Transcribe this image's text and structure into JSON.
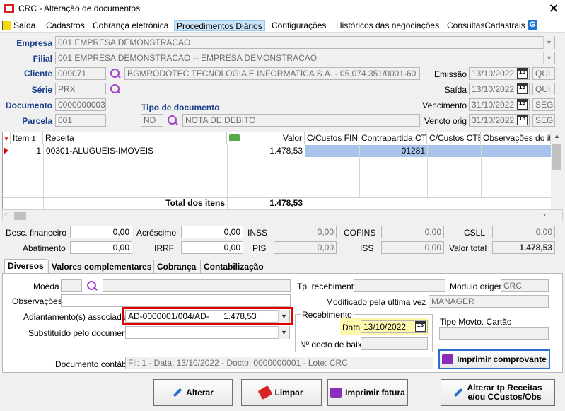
{
  "window": {
    "title": "CRC - Alteração de documentos",
    "close_label": "✕"
  },
  "menu": [
    {
      "label": "Saída"
    },
    {
      "label": "Cadastros"
    },
    {
      "label": "Cobrança eletrônica"
    },
    {
      "label": "Procedimentos Diários"
    },
    {
      "label": "Configurações"
    },
    {
      "label": "Históricos das negociações"
    },
    {
      "label": "ConsultasCadastrais"
    }
  ],
  "menu_g_icon": "G",
  "header": {
    "empresa_label": "Empresa",
    "empresa_value": "001 EMPRESA DEMONSTRACAO",
    "filial_label": "Filial",
    "filial_value": "001 EMPRESA DEMONSTRACAO -- EMPRESA DEMONSTRACAO",
    "cliente_label": "Cliente",
    "cliente_code": "009071",
    "cliente_name": "BGMRODOTEC TECNOLOGIA E INFORMATICA S.A. - 05.074.351/0001-60",
    "serie_label": "Série",
    "serie_value": "PRX",
    "documento_label": "Documento",
    "documento_value": "0000000003",
    "parcela_label": "Parcela",
    "parcela_value": "001",
    "tipo_doc_label": "Tipo de documento",
    "tipo_doc_code": "ND",
    "tipo_doc_name": "NOTA DE DEBITO",
    "emissao_label": "Emissão",
    "emissao_date": "13/10/2022",
    "emissao_day": "QUI",
    "saida_label": "Saída",
    "saida_date": "13/10/2022",
    "saida_day": "QUI",
    "vencimento_label": "Vencimento",
    "vencimento_date": "31/10/2022",
    "vencimento_day": "SEG",
    "vencto_orig_label": "Vencto orig",
    "vencto_orig_date": "31/10/2022",
    "vencto_orig_day": "SEG",
    "cal_glyph": "15"
  },
  "grid": {
    "columns": [
      "Item",
      "Receita",
      "Valor",
      "C/Custos FIN",
      "Contrapartida CTB",
      "C/Custos CTB",
      "Observações do item"
    ],
    "sort_glyph": "1",
    "rows": [
      {
        "item": "1",
        "receita": "00301-ALUGUEIS-IMOVEIS",
        "valor": "1.478,53",
        "ccustos_fin": "",
        "contrapartida": "01281",
        "ccustos_ctb": "",
        "obs": ""
      }
    ],
    "total_label": "Total dos itens",
    "total_value": "1.478,53"
  },
  "totals": {
    "desc_fin_label": "Desc. financeiro",
    "desc_fin": "0,00",
    "acrescimo_label": "Acréscimo",
    "acrescimo": "0,00",
    "inss_label": "INSS",
    "inss": "0,00",
    "cofins_label": "COFINS",
    "cofins": "0,00",
    "csll_label": "CSLL",
    "csll": "0,00",
    "abatimento_label": "Abatimento",
    "abatimento": "0,00",
    "irrf_label": "IRRF",
    "irrf": "0,00",
    "pis_label": "PIS",
    "pis": "0,00",
    "iss_label": "ISS",
    "iss": "0,00",
    "valor_total_label": "Valor total",
    "valor_total": "1.478,53"
  },
  "tabs": [
    {
      "label": "Diversos"
    },
    {
      "label": "Valores complementares"
    },
    {
      "label": "Cobrança"
    },
    {
      "label": "Contabilização"
    }
  ],
  "diversos": {
    "moeda_label": "Moeda",
    "moeda_value": "",
    "observacoes_label": "Observações",
    "observacoes_value": "",
    "adiantamento_label": "Adiantamento(s) associado(s)",
    "adiantamento_doc": "AD-0000001/004/AD-",
    "adiantamento_valor": "1.478,53",
    "substituido_label": "Substituído pelo documento",
    "substituido_value": "",
    "tp_recebimento_label": "Tp. recebimento",
    "tp_recebimento_value": "",
    "modulo_origem_label": "Módulo origem",
    "modulo_origem_value": "CRC",
    "modificado_label": "Modificado pela última vez por",
    "modificado_value": "MANAGER",
    "recebimento_group": "Recebimento",
    "data_label": "Data",
    "data_value": "13/10/2022",
    "n_docto_label": "Nº docto de baixa",
    "n_docto_value": "",
    "tipo_movto_label": "Tipo Movto. Cartão",
    "tipo_movto_value": "",
    "doc_contabil_label": "Documento contábil",
    "doc_contabil_value": "Fil: 1 - Data: 13/10/2022 - Docto: 0000000001 - Lote: CRC",
    "imprimir_comprovante": "Imprimir comprovante"
  },
  "buttons": {
    "alterar": "Alterar",
    "limpar": "Limpar",
    "imprimir_fatura": "Imprimir fatura",
    "alterar_tp_line1": "Alterar tp Receitas",
    "alterar_tp_line2": "e/ou CCustos/Obs"
  },
  "colors": {
    "accent_label": "#1a3e8c",
    "selection": "#a9c4ea",
    "highlight_yellow": "#fff9b0",
    "highlight_red": "#e00000"
  }
}
